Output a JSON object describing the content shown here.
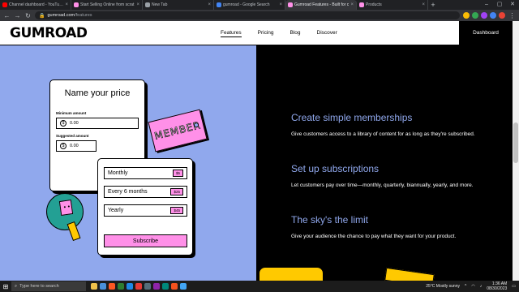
{
  "browser": {
    "tabs": [
      {
        "title": "Channel dashboard - YouTube S",
        "favicon_color": "#ff0000",
        "active": false
      },
      {
        "title": "Start Selling Online from scrat",
        "favicon_color": "#ff90e8",
        "active": false
      },
      {
        "title": "New Tab",
        "favicon_color": "#9aa0a6",
        "active": false
      },
      {
        "title": "gumroad - Google Search",
        "favicon_color": "#4285f4",
        "active": false
      },
      {
        "title": "Gumroad Features - Built for c",
        "favicon_color": "#ff90e8",
        "active": true
      },
      {
        "title": "Products",
        "favicon_color": "#ff90e8",
        "active": false
      }
    ],
    "url_domain": "gumroad.com",
    "url_path": "/features",
    "extension_colors": [
      "#fbbc04",
      "#34a853",
      "#a142f4",
      "#4285f4",
      "#ea4335"
    ]
  },
  "site": {
    "logo": "GUMROAD",
    "nav": [
      "Features",
      "Pricing",
      "Blog",
      "Discover"
    ],
    "active_nav": "Features",
    "dashboard_label": "Dashboard"
  },
  "illustration": {
    "nyp_title": "Name your price",
    "min_label": "Minimum amount",
    "min_value": "0.00",
    "suggested_label": "Suggested amount",
    "suggested_value": "0.00",
    "coin_symbol": "$",
    "member_tag": "MEMBER",
    "options": [
      {
        "label": "Monthly",
        "price": "$5"
      },
      {
        "label": "Every 6 months",
        "price": "$25"
      },
      {
        "label": "Yearly",
        "price": "$45"
      }
    ],
    "subscribe_label": "Subscribe"
  },
  "features": [
    {
      "title": "Create simple memberships",
      "text": "Give customers access to a library of content for as long as they're subscribed."
    },
    {
      "title": "Set up subscriptions",
      "text": "Let customers pay over time—monthly, quarterly, biannually, yearly, and more."
    },
    {
      "title": "The sky's the limit",
      "text": "Give your audience the chance to pay what they want for your product."
    }
  ],
  "taskbar": {
    "search_placeholder": "Type here to search",
    "app_colors": [
      "#f0c24b",
      "#4a90d9",
      "#ff5722",
      "#2e7d32",
      "#1e88e5",
      "#e53935",
      "#546e7a",
      "#8e24aa",
      "#00897b",
      "#f4511e",
      "#42a5f5"
    ],
    "weather": "25°C  Mostly sunny",
    "time": "1:36 AM",
    "date": "08/30/2023"
  }
}
